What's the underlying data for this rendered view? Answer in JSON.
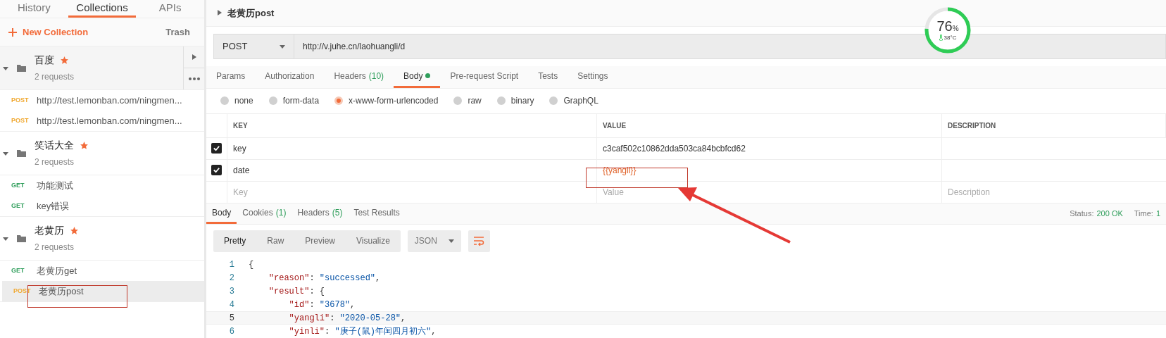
{
  "sidebar": {
    "tabs": [
      {
        "label": "History",
        "selected": false
      },
      {
        "label": "Collections",
        "selected": true
      },
      {
        "label": "APIs",
        "selected": false
      }
    ],
    "new_collection": "New Collection",
    "trash": "Trash",
    "collections": [
      {
        "name": "百度",
        "starred": true,
        "count": "2 requests",
        "hovered": true,
        "requests": [
          {
            "method": "POST",
            "name": "http://test.lemonban.com/ningmen...",
            "selected": false
          },
          {
            "method": "POST",
            "name": "http://test.lemonban.com/ningmen...",
            "selected": false
          }
        ]
      },
      {
        "name": "笑话大全",
        "starred": true,
        "count": "2 requests",
        "hovered": false,
        "requests": [
          {
            "method": "GET",
            "name": "功能测试",
            "selected": false
          },
          {
            "method": "GET",
            "name": "key错误",
            "selected": false
          }
        ]
      },
      {
        "name": "老黄历",
        "starred": true,
        "count": "2 requests",
        "hovered": false,
        "requests": [
          {
            "method": "GET",
            "name": "老黄历get",
            "selected": false
          },
          {
            "method": "POST",
            "name": "老黄历post",
            "selected": true
          }
        ]
      }
    ]
  },
  "request": {
    "title": "老黄历post",
    "method": "POST",
    "url": "http://v.juhe.cn/laohuangli/d",
    "tabs": [
      {
        "label": "Params",
        "dot": false,
        "selected": false
      },
      {
        "label": "Authorization",
        "dot": false,
        "selected": false
      },
      {
        "label": "Headers",
        "count": "(10)",
        "dot": false,
        "selected": false
      },
      {
        "label": "Body",
        "dot": true,
        "selected": true
      },
      {
        "label": "Pre-request Script",
        "dot": false,
        "selected": false
      },
      {
        "label": "Tests",
        "dot": false,
        "selected": false
      },
      {
        "label": "Settings",
        "dot": false,
        "selected": false
      }
    ],
    "body_types": [
      {
        "label": "none",
        "selected": false
      },
      {
        "label": "form-data",
        "selected": false
      },
      {
        "label": "x-www-form-urlencoded",
        "selected": true
      },
      {
        "label": "raw",
        "selected": false
      },
      {
        "label": "binary",
        "selected": false
      },
      {
        "label": "GraphQL",
        "selected": false
      }
    ],
    "table": {
      "columns": [
        "KEY",
        "VALUE",
        "DESCRIPTION"
      ],
      "rows": [
        {
          "checked": true,
          "key": "key",
          "value": "c3caf502c10862dda503ca84bcbfcd62",
          "variable": false
        },
        {
          "checked": true,
          "key": "date",
          "value": "{{yangli}}",
          "variable": true
        }
      ],
      "placeholders": {
        "key": "Key",
        "value": "Value",
        "description": "Description"
      }
    }
  },
  "response": {
    "tabs": [
      {
        "label": "Body",
        "selected": true
      },
      {
        "label": "Cookies",
        "count": "(1)",
        "selected": false
      },
      {
        "label": "Headers",
        "count": "(5)",
        "selected": false
      },
      {
        "label": "Test Results",
        "selected": false
      }
    ],
    "status_label": "Status:",
    "status": "200 OK",
    "time_label": "Time:",
    "time": "1",
    "views": [
      {
        "label": "Pretty",
        "selected": true
      },
      {
        "label": "Raw",
        "selected": false
      },
      {
        "label": "Preview",
        "selected": false
      },
      {
        "label": "Visualize",
        "selected": false
      }
    ],
    "format": "JSON",
    "lines": [
      {
        "number": "1",
        "text": "{",
        "highlighted": false
      },
      {
        "number": "2",
        "text": "    \"reason\": \"successed\",",
        "highlighted": false
      },
      {
        "number": "3",
        "text": "    \"result\": {",
        "highlighted": false
      },
      {
        "number": "4",
        "text": "        \"id\": \"3678\",",
        "highlighted": false
      },
      {
        "number": "5",
        "text": "        \"yangli\": \"2020-05-28\",",
        "highlighted": true
      },
      {
        "number": "6",
        "text": "        \"yinli\": \"庚子(鼠)年闰四月初六\",",
        "highlighted": false
      }
    ]
  },
  "gauge": {
    "value": "76",
    "unit": "%",
    "temperature": "38°C",
    "level": 0.76
  }
}
